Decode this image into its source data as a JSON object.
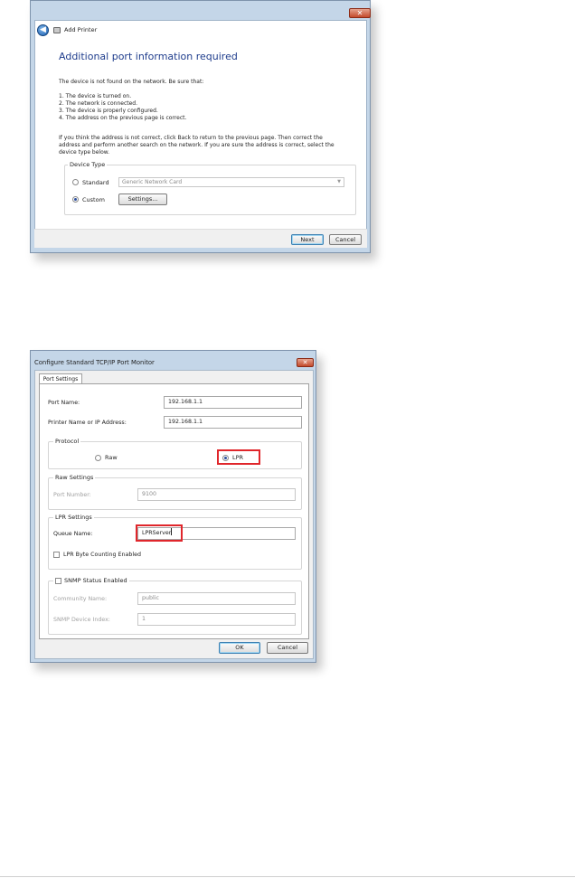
{
  "add_printer": {
    "title": "Add Printer",
    "close_glyph": "✕",
    "back_glyph": "◀",
    "heading": "Additional port information required",
    "intro": "The device is not found on the network.  Be sure that:",
    "checklist": [
      "1.   The device is turned on.",
      "2.   The network is connected.",
      "3.   The device is properly configured.",
      "4.   The address on the previous page is correct."
    ],
    "advice_lines": [
      "If you think the address is not correct, click Back to return to the previous page.  Then correct the",
      "address and perform another search on the network.  If you are sure the address is correct, select the",
      "device type below."
    ],
    "device_type_legend": "Device Type",
    "standard_label": "Standard",
    "standard_selected": false,
    "standard_value": "Generic Network Card",
    "custom_label": "Custom",
    "custom_selected": true,
    "settings_button": "Settings...",
    "next_button": "Next",
    "cancel_button": "Cancel"
  },
  "port_monitor": {
    "title": "Configure Standard TCP/IP Port Monitor",
    "close_glyph": "✕",
    "tab_label": "Port Settings",
    "port_name_label": "Port Name:",
    "port_name_value": "192.168.1.1",
    "printer_name_label": "Printer Name or IP Address:",
    "printer_name_value": "192.168.1.1",
    "protocol_legend": "Protocol",
    "raw_label": "Raw",
    "raw_selected": false,
    "lpr_label": "LPR",
    "lpr_selected": true,
    "raw_settings_legend": "Raw Settings",
    "port_number_label": "Port Number:",
    "port_number_value": "9100",
    "lpr_settings_legend": "LPR Settings",
    "queue_name_label": "Queue Name:",
    "queue_name_value": "LPRServer",
    "lpr_byte_counting_label": "LPR Byte Counting Enabled",
    "lpr_byte_counting_checked": false,
    "snmp_label": "SNMP Status Enabled",
    "snmp_checked": false,
    "community_name_label": "Community Name:",
    "community_name_value": "public",
    "snmp_index_label": "SNMP Device Index:",
    "snmp_index_value": "1",
    "ok_button": "OK",
    "cancel_button": "Cancel"
  },
  "colors": {
    "heading_blue": "#1e3c8c",
    "highlight_red": "#e0262b",
    "window_frame": "#c4d6e8"
  }
}
